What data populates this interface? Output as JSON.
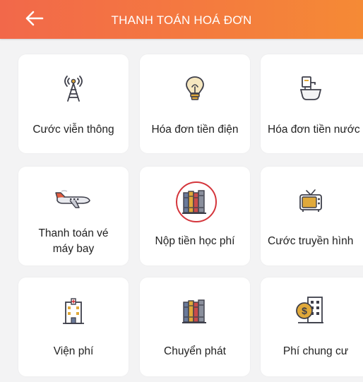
{
  "header": {
    "title": "THANH TOÁN HOÁ ĐƠN",
    "background": "#f47a3f"
  },
  "services": [
    {
      "label": "Cước viễn thông",
      "icon": "antenna-icon"
    },
    {
      "label": "Hóa đơn tiền điện",
      "icon": "lightbulb-icon"
    },
    {
      "label": "Hóa đơn tiền nước",
      "icon": "water-tap-icon"
    },
    {
      "label_line1": "Thanh toán vé",
      "label_line2": "máy bay",
      "icon": "airplane-icon"
    },
    {
      "label": "Nộp tiền học phí",
      "icon": "books-icon",
      "highlighted": true
    },
    {
      "label": "Cước truyền hình",
      "icon": "tv-icon"
    },
    {
      "label": "Viện phí",
      "icon": "hospital-icon"
    },
    {
      "label": "Chuyển phát",
      "icon": "parcel-icon"
    },
    {
      "label": "Phí chung cư",
      "icon": "apartment-icon"
    }
  ],
  "colors": {
    "accent": "#f47a3f",
    "highlight_ring": "#d4353b",
    "icon_gold": "#e0a93a",
    "icon_dark": "#3e3f4a"
  }
}
